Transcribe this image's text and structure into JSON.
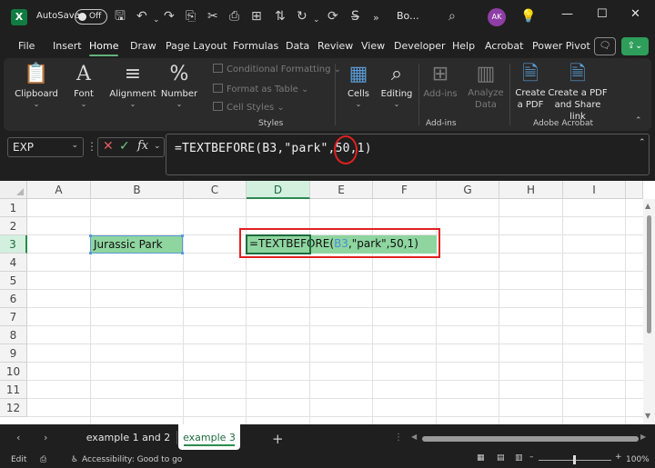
{
  "titlebar": {
    "app_icon": "excel-logo-icon",
    "app_letter": "X",
    "autosave_label": "AutoSave",
    "autosave_state": "Off",
    "book_name": "Bo...",
    "user_initials": "AK"
  },
  "menu": {
    "items": [
      "File",
      "Insert",
      "Home",
      "Draw",
      "Page Layout",
      "Formulas",
      "Data",
      "Review",
      "View",
      "Developer",
      "Help",
      "Acrobat",
      "Power Pivot"
    ],
    "active": "Home"
  },
  "ribbon": {
    "clipboard": "Clipboard",
    "font": "Font",
    "alignment": "Alignment",
    "number": "Number",
    "conditional_formatting": "Conditional Formatting",
    "format_as_table": "Format as Table",
    "cell_styles": "Cell Styles",
    "styles_group": "Styles",
    "cells": "Cells",
    "editing": "Editing",
    "add_ins": "Add-ins",
    "add_ins_group": "Add-ins",
    "analyze_data_1": "Analyze",
    "analyze_data_2": "Data",
    "create_pdf_1": "Create",
    "create_pdf_2": "a PDF",
    "create_share_1": "Create a PDF",
    "create_share_2": "and Share link",
    "adobe_group": "Adobe Acrobat"
  },
  "formula_bar": {
    "name_box": "EXP",
    "fx_label": "fx",
    "formula": "=TEXTBEFORE(B3,\"park\",50,1)"
  },
  "grid": {
    "columns": [
      "A",
      "B",
      "C",
      "D",
      "E",
      "F",
      "G",
      "H",
      "I"
    ],
    "rows": [
      "1",
      "2",
      "3",
      "4",
      "5",
      "6",
      "7",
      "8",
      "9",
      "10",
      "11",
      "12"
    ],
    "selected_column": "D",
    "selected_row": "3",
    "b3_value": "Jurassic Park",
    "d3_prefix": "=TEXTBEFORE(",
    "d3_ref": "B3",
    "d3_suffix": ",\"park\",50,1)"
  },
  "sheets": {
    "tabs": [
      "example 1 and 2",
      "example 3"
    ],
    "active": "example 3"
  },
  "status": {
    "mode": "Edit",
    "accessibility": "Accessibility: Good to go",
    "zoom": "100%"
  },
  "colors": {
    "excel_green": "#107c41",
    "highlight_green": "#8ed59f",
    "annotation_red": "#e02020"
  }
}
